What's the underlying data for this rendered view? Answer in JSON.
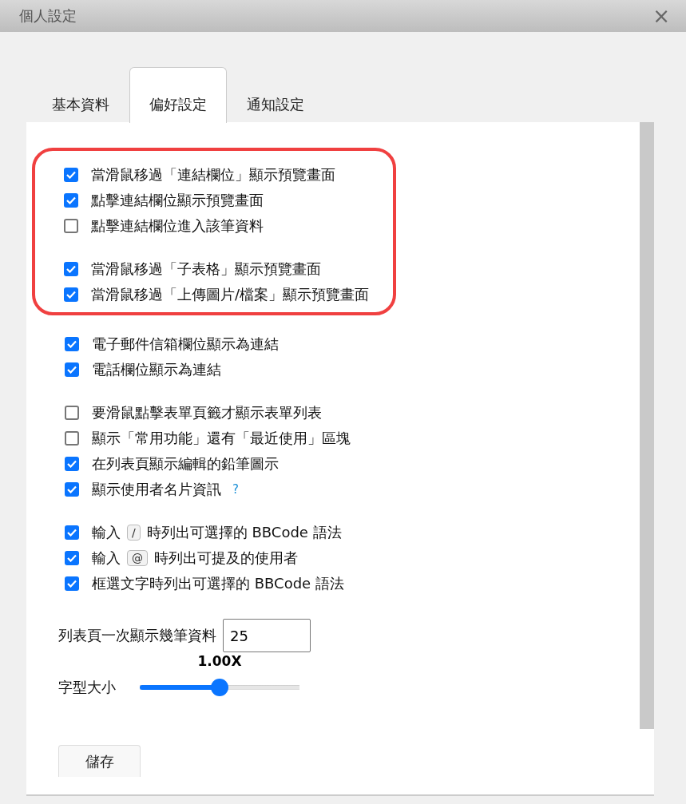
{
  "window": {
    "title": "個人設定",
    "close": "×"
  },
  "tabs": [
    {
      "label": "基本資料",
      "selected": false
    },
    {
      "label": "偏好設定",
      "selected": true
    },
    {
      "label": "通知設定",
      "selected": false
    }
  ],
  "sections": [
    {
      "highlighted": true,
      "groups": [
        [
          {
            "label": "當滑鼠移過「連結欄位」顯示預覽畫面",
            "checked": true
          },
          {
            "label": "點擊連結欄位顯示預覽畫面",
            "checked": true
          },
          {
            "label": "點擊連結欄位進入該筆資料",
            "checked": false
          }
        ],
        [
          {
            "label": "當滑鼠移過「子表格」顯示預覽畫面",
            "checked": true
          },
          {
            "label": "當滑鼠移過「上傳圖片/檔案」顯示預覽畫面",
            "checked": true
          }
        ]
      ]
    },
    {
      "highlighted": false,
      "groups": [
        [
          {
            "label": "電子郵件信箱欄位顯示為連結",
            "checked": true
          },
          {
            "label": "電話欄位顯示為連結",
            "checked": true
          }
        ],
        [
          {
            "label": "要滑鼠點擊表單頁籤才顯示表單列表",
            "checked": false
          },
          {
            "label": "顯示「常用功能」還有「最近使用」區塊",
            "checked": false
          },
          {
            "label": "在列表頁顯示編輯的鉛筆圖示",
            "checked": true
          },
          {
            "label": "顯示使用者名片資訊",
            "checked": true,
            "help": "?"
          }
        ],
        [
          {
            "label": "輸入",
            "key": "/",
            "after": "時列出可選擇的 BBCode 語法",
            "checked": true
          },
          {
            "label": "輸入",
            "key": "@",
            "after": "時列出可提及的使用者",
            "checked": true
          },
          {
            "label": "框選文字時列出可選擇的 BBCode 語法",
            "checked": true
          }
        ]
      ]
    }
  ],
  "page_size": {
    "label": "列表頁一次顯示幾筆資料",
    "value": "25"
  },
  "font_size": {
    "label": "字型大小",
    "reading": "1.00X",
    "level": 0.5
  },
  "save_button": "儲存"
}
